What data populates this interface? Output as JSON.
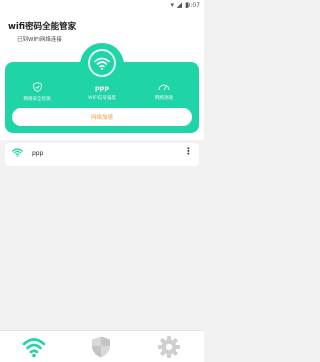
{
  "status_bar": {
    "time": "9:07"
  },
  "header": {
    "title": "wifi密码全能管家",
    "subtitle": "已到WIFI网络连接"
  },
  "card": {
    "ssid": "ppp",
    "stats": [
      {
        "icon": "shield-check-icon",
        "label": "网络安全检测"
      },
      {
        "icon": "wifi-icon",
        "label": "WIFI信号强度"
      },
      {
        "icon": "speedometer-icon",
        "label": "网络测速"
      }
    ],
    "action_label": "网络加速"
  },
  "networks": [
    {
      "name": "ppp",
      "icon": "wifi-icon"
    }
  ],
  "bottom_nav": [
    {
      "name": "wifi-tab",
      "icon": "wifi-icon",
      "active": true
    },
    {
      "name": "security-tab",
      "icon": "shield-icon",
      "active": false
    },
    {
      "name": "settings-tab",
      "icon": "gear-icon",
      "active": false
    }
  ],
  "colors": {
    "accent": "#1fd4a6",
    "action_text": "#e6a23c"
  }
}
